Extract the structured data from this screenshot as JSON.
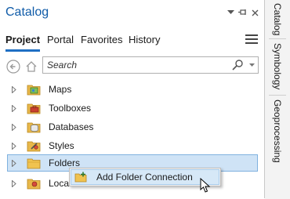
{
  "pane": {
    "title": "Catalog",
    "controls": {
      "dropdown_icon": "chevron-down-icon",
      "pin_icon": "pin-icon",
      "close_icon": "close-icon"
    }
  },
  "tabs": [
    {
      "label": "Project",
      "active": true
    },
    {
      "label": "Portal",
      "active": false
    },
    {
      "label": "Favorites",
      "active": false
    },
    {
      "label": "History",
      "active": false
    }
  ],
  "menu_icon": "hamburger-menu-icon",
  "nav": {
    "back_icon": "back-arrow-icon",
    "home_icon": "home-icon"
  },
  "search": {
    "placeholder": "Search",
    "value": "",
    "icon": "search-icon",
    "dropdown_icon": "chevron-down-icon"
  },
  "tree": {
    "items": [
      {
        "label": "Maps",
        "icon": "maps-folder-icon",
        "selected": false
      },
      {
        "label": "Toolboxes",
        "icon": "toolboxes-folder-icon",
        "selected": false
      },
      {
        "label": "Databases",
        "icon": "databases-folder-icon",
        "selected": false
      },
      {
        "label": "Styles",
        "icon": "styles-folder-icon",
        "selected": false
      },
      {
        "label": "Folders",
        "icon": "folders-icon",
        "selected": true
      },
      {
        "label": "Locato",
        "icon": "locators-folder-icon",
        "selected": false
      }
    ]
  },
  "context_menu": {
    "items": [
      {
        "label": "Add Folder Connection",
        "icon": "add-folder-connection-icon"
      }
    ]
  },
  "side_tabs": [
    {
      "label": "Catalog"
    },
    {
      "label": "Symbology"
    },
    {
      "label": "Geoprocessing"
    }
  ],
  "colors": {
    "title": "#0f5ba8",
    "tab_underline": "#1f6fc4",
    "selection_bg": "#cfe3f6",
    "selection_border": "#7fb1df",
    "menu_bg": "#f2f2f2",
    "menu_hover": "#d6e8f7"
  }
}
